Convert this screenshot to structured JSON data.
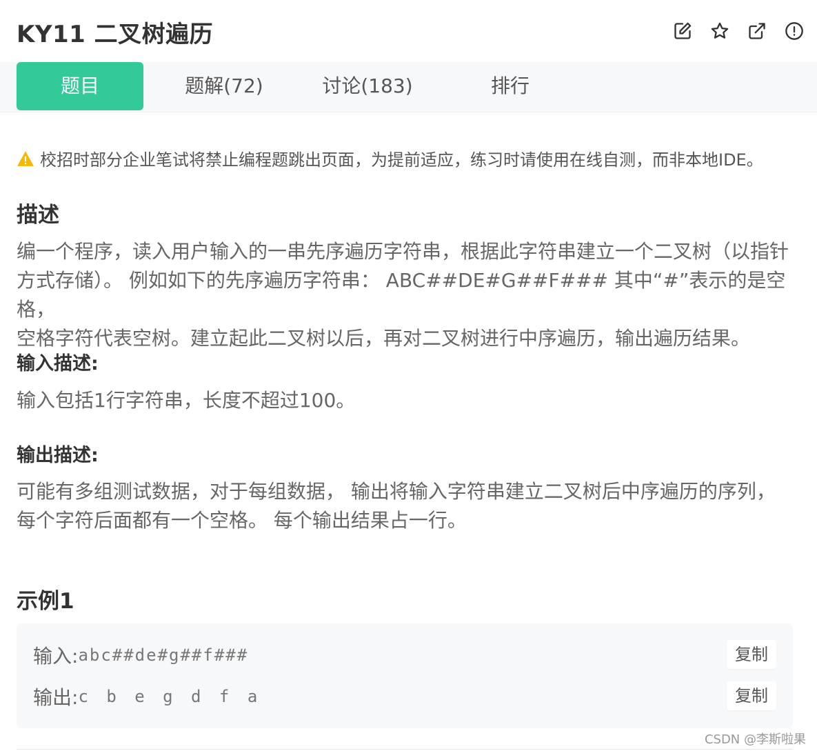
{
  "header": {
    "title": "KY11  二叉树遍历",
    "icons": [
      "edit-icon",
      "star-icon",
      "share-icon",
      "report-icon"
    ]
  },
  "tabs": [
    {
      "label": "题目",
      "active": true
    },
    {
      "label": "题解(72)",
      "active": false
    },
    {
      "label": "讨论(183)",
      "active": false
    },
    {
      "label": "排行",
      "active": false
    }
  ],
  "notice": {
    "icon": "warning-icon",
    "text": "校招时部分企业笔试将禁止编程题跳出页面，为提前适应，练习时请使用在线自测，而非本地IDE。"
  },
  "description": {
    "heading": "描述",
    "lines": [
      "编一个程序，读入用户输入的一串先序遍历字符串，根据此字符串建立一个二叉树（以指针",
      "方式存储）。 例如如下的先序遍历字符串： ABC##DE#G##F### 其中“#”表示的是空格，",
      "空格字符代表空树。建立起此二叉树以后，再对二叉树进行中序遍历，输出遍历结果。"
    ]
  },
  "input_desc": {
    "heading": "输入描述:",
    "text": "输入包括1行字符串，长度不超过100。"
  },
  "output_desc": {
    "heading": "输出描述:",
    "lines": [
      "可能有多组测试数据，对于每组数据， 输出将输入字符串建立二叉树后中序遍历的序列，",
      "每个字符后面都有一个空格。 每个输出结果占一行。"
    ]
  },
  "example": {
    "heading": "示例1",
    "input_label": "输入:",
    "input_value": "abc##de#g##f###",
    "output_label": "输出:",
    "output_value": "c b e g d f a",
    "copy_label": "复制"
  },
  "watermark": "CSDN @李斯啦果",
  "colors": {
    "accent": "#32ca99",
    "tabbar_bg": "#f7f8fa",
    "warning": "#f5b800"
  }
}
